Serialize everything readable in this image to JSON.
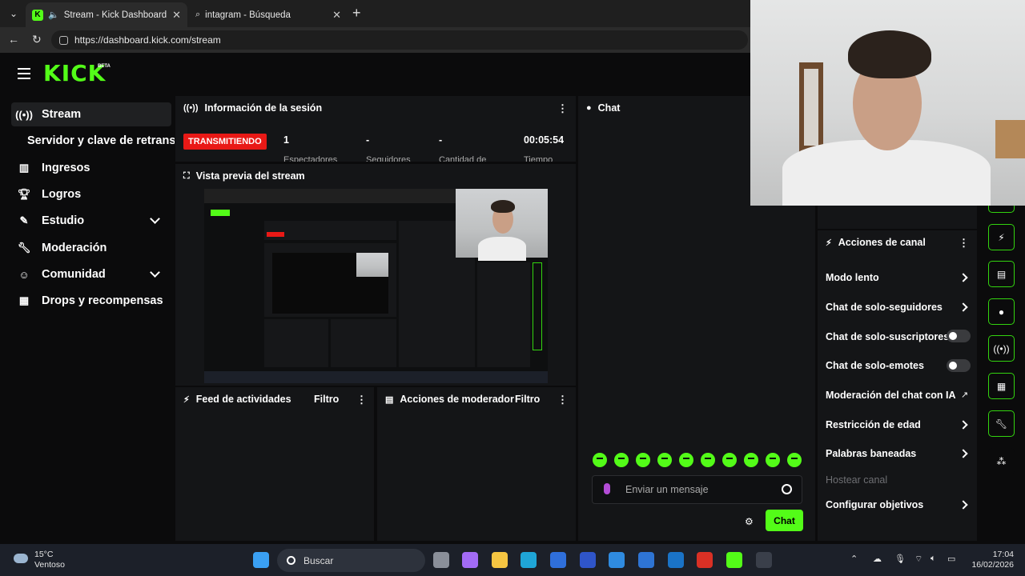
{
  "browser": {
    "tabs": [
      {
        "title": "Stream - Kick Dashboard"
      },
      {
        "title": "intagram - Búsqueda"
      }
    ],
    "url": "https://dashboard.kick.com/stream"
  },
  "topnav": {
    "logo": "KICK",
    "beta": "BETA"
  },
  "sidebar": {
    "items": [
      {
        "label": "Stream",
        "icon": "broadcast-icon"
      },
      {
        "label": "Servidor y clave de retransmisión"
      },
      {
        "label": "Ingresos",
        "icon": "chart-icon"
      },
      {
        "label": "Logros",
        "icon": "trophy-icon"
      },
      {
        "label": "Estudio",
        "icon": "studio-icon"
      },
      {
        "label": "Moderación",
        "icon": "wrench-icon"
      },
      {
        "label": "Comunidad",
        "icon": "community-icon"
      },
      {
        "label": "Drops y recompensas",
        "icon": "gift-icon"
      }
    ]
  },
  "session": {
    "title": "Información de la sesión",
    "status": "TRANSMITIENDO",
    "stats": [
      {
        "value": "1",
        "label": "Espectadores"
      },
      {
        "value": "-",
        "label": "Seguidores"
      },
      {
        "value": "-",
        "label": "Cantidad de"
      },
      {
        "value": "00:05:54",
        "label": "Tiempo"
      }
    ]
  },
  "preview": {
    "title": "Vista previa del stream"
  },
  "activity": {
    "title": "Feed de actividades",
    "filter": "Filtro"
  },
  "modactions": {
    "title": "Acciones de moderador",
    "filter": "Filtro"
  },
  "chat": {
    "title": "Chat",
    "placeholder": "Enviar un mensaje",
    "send": "Chat"
  },
  "channel": {
    "title": "Acciones de canal",
    "items": [
      {
        "label": "Modo lento",
        "control": "chevron"
      },
      {
        "label": "Chat de solo-seguidores",
        "control": "chevron"
      },
      {
        "label": "Chat de solo-suscriptores",
        "control": "toggle"
      },
      {
        "label": "Chat de solo-emotes",
        "control": "toggle"
      },
      {
        "label": "Moderación del chat con IA",
        "control": "external"
      },
      {
        "label": "Restricción de edad",
        "control": "chevron"
      },
      {
        "label": "Palabras baneadas",
        "control": "chevron"
      },
      {
        "label": "Hostear canal",
        "control": "none"
      },
      {
        "label": "Configurar objetivos",
        "control": "chevron"
      }
    ]
  },
  "taskbar": {
    "temp": "15°C",
    "weather": "Ventoso",
    "search": "Buscar",
    "time": "17:04",
    "date": "16/02/2026"
  },
  "colors": {
    "accent": "#53fc18",
    "live": "#e91916",
    "panel": "#141517",
    "bg": "#0b0b0c"
  }
}
